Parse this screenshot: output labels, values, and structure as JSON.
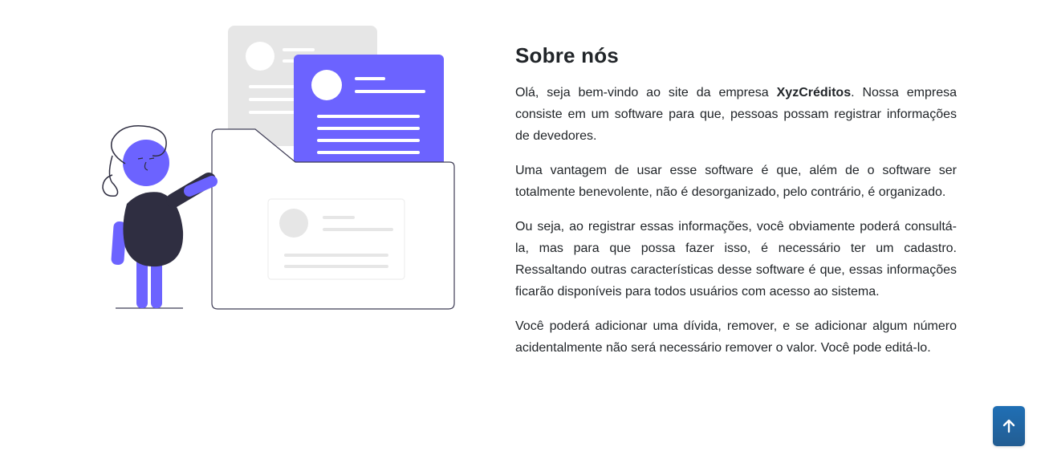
{
  "about": {
    "title": "Sobre nós",
    "paragraph1_before": "Olá, seja bem-vindo ao site da empresa ",
    "company_name": "XyzCréditos",
    "paragraph1_after": ". Nossa empresa consiste em um software para que, pessoas possam registrar informações de devedores.",
    "paragraph2": "Uma vantagem de usar esse software é que, além de o software ser totalmente benevolente, não é desorganizado, pelo contrário, é organizado.",
    "paragraph3": "Ou seja, ao registrar essas informações, você obviamente poderá consultá-la, mas para que possa fazer isso, é necessário ter um cadastro. Ressaltando outras características desse software é que, essas informações ficarão disponíveis para todos usuários com acesso ao sistema.",
    "paragraph4": "Você poderá adicionar uma dívida, remover, e se adicionar algum número acidentalmente não será necessário remover o valor. Você pode editá-lo."
  },
  "illustration": {
    "icon": "person-with-folder-illustration",
    "accent_color": "#6c63ff",
    "dark_color": "#2f2e41",
    "light_gray": "#e6e6e6"
  },
  "back_to_top": {
    "icon": "arrow-up-icon",
    "color": "#1f6fb5"
  }
}
